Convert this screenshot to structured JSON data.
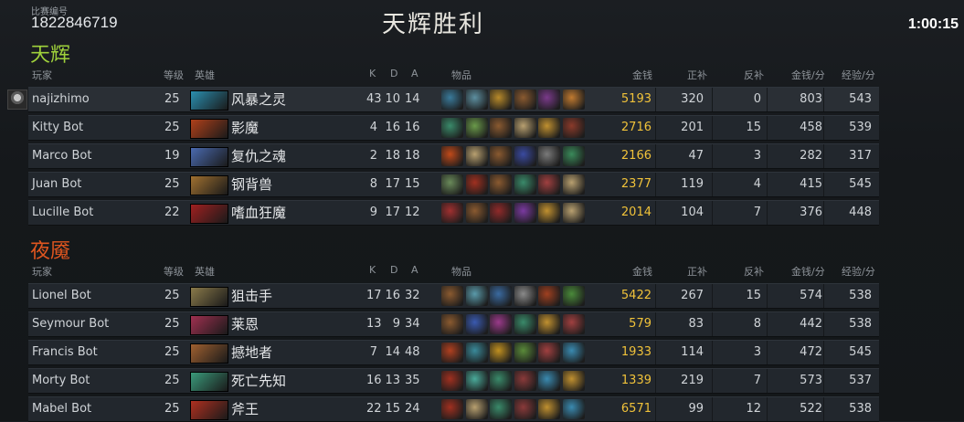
{
  "header": {
    "match_label": "比赛编号",
    "match_id": "1822846719",
    "result": "天辉胜利",
    "time": "1:00:15"
  },
  "columns": {
    "player": "玩家",
    "level": "等级",
    "hero": "英雄",
    "k": "K",
    "d": "D",
    "a": "A",
    "items": "物品",
    "gold": "金钱",
    "last_hits": "正补",
    "denies": "反补",
    "gpm": "金钱/分",
    "xpm": "经验/分"
  },
  "radiant": {
    "name": "天辉",
    "players": [
      {
        "name": "najizhimo",
        "level": "25",
        "hero": "风暴之灵",
        "k": "43",
        "d": "10",
        "a": "14",
        "gold": "5193",
        "lh": "320",
        "dn": "0",
        "gpm": "803",
        "xpm": "543",
        "hero_color": "#2a8fb0",
        "items": [
          "#3a7a9a",
          "#5d8fa0",
          "#b88a2a",
          "#8a5a30",
          "#7a3a8a",
          "#c07a30"
        ]
      },
      {
        "name": "Kitty Bot",
        "level": "25",
        "hero": "影魔",
        "k": "4",
        "d": "16",
        "a": "16",
        "gold": "2716",
        "lh": "201",
        "dn": "15",
        "gpm": "458",
        "xpm": "539",
        "hero_color": "#b0401a",
        "items": [
          "#3a8a6a",
          "#6a9a4a",
          "#8a5a30",
          "#b8a070",
          "#c09030",
          "#8a3a2a"
        ]
      },
      {
        "name": "Marco Bot",
        "level": "19",
        "hero": "复仇之魂",
        "k": "2",
        "d": "18",
        "a": "18",
        "gold": "2166",
        "lh": "47",
        "dn": "3",
        "gpm": "282",
        "xpm": "317",
        "hero_color": "#4a6ab0",
        "items": [
          "#c04a1a",
          "#b8a070",
          "#8a5a30",
          "#3a4aa0",
          "#7a7a7a",
          "#3a8a5a"
        ]
      },
      {
        "name": "Juan Bot",
        "level": "25",
        "hero": "钢背兽",
        "k": "8",
        "d": "17",
        "a": "15",
        "gold": "2377",
        "lh": "119",
        "dn": "4",
        "gpm": "415",
        "xpm": "545",
        "hero_color": "#a07030",
        "items": [
          "#6a8a5a",
          "#a03020",
          "#8a5a30",
          "#3a8a6a",
          "#a04040",
          "#b8a070"
        ]
      },
      {
        "name": "Lucille Bot",
        "level": "22",
        "hero": "嗜血狂魔",
        "k": "9",
        "d": "17",
        "a": "12",
        "gold": "2014",
        "lh": "104",
        "dn": "7",
        "gpm": "376",
        "xpm": "448",
        "hero_color": "#a02020",
        "items": [
          "#a03030",
          "#8a5a30",
          "#902a2a",
          "#7a3aa0",
          "#c09030",
          "#b8a070"
        ]
      }
    ]
  },
  "dire": {
    "name": "夜魇",
    "players": [
      {
        "name": "Lionel Bot",
        "level": "25",
        "hero": "狙击手",
        "k": "17",
        "d": "16",
        "a": "32",
        "gold": "5422",
        "lh": "267",
        "dn": "15",
        "gpm": "574",
        "xpm": "538",
        "hero_color": "#8a7a4a",
        "items": [
          "#8a5a30",
          "#5a9aaa",
          "#3a6aa0",
          "#8a8a8a",
          "#a04020",
          "#4a8a3a"
        ]
      },
      {
        "name": "Seymour Bot",
        "level": "25",
        "hero": "莱恩",
        "k": "13",
        "d": "9",
        "a": "34",
        "gold": "579",
        "lh": "83",
        "dn": "8",
        "gpm": "442",
        "xpm": "538",
        "hero_color": "#a03050",
        "items": [
          "#8a5a30",
          "#3a5ab0",
          "#9a3a8a",
          "#3a8a6a",
          "#c09030",
          "#a04040"
        ]
      },
      {
        "name": "Francis Bot",
        "level": "25",
        "hero": "撼地者",
        "k": "7",
        "d": "14",
        "a": "48",
        "gold": "1933",
        "lh": "114",
        "dn": "3",
        "gpm": "472",
        "xpm": "545",
        "hero_color": "#a06030",
        "items": [
          "#b04020",
          "#3a8a9a",
          "#c09020",
          "#5a8a3a",
          "#a04040",
          "#3a8ab0"
        ]
      },
      {
        "name": "Morty Bot",
        "level": "25",
        "hero": "死亡先知",
        "k": "16",
        "d": "13",
        "a": "35",
        "gold": "1339",
        "lh": "219",
        "dn": "7",
        "gpm": "573",
        "xpm": "537",
        "hero_color": "#3a9a7a",
        "items": [
          "#a03020",
          "#4aaa9a",
          "#3a8a6a",
          "#8a3a3a",
          "#3a8ab0",
          "#c09030"
        ]
      },
      {
        "name": "Mabel Bot",
        "level": "25",
        "hero": "斧王",
        "k": "22",
        "d": "15",
        "a": "24",
        "gold": "6571",
        "lh": "99",
        "dn": "12",
        "gpm": "522",
        "xpm": "538",
        "hero_color": "#b03020",
        "items": [
          "#a03020",
          "#b8a070",
          "#3a8a6a",
          "#8a3a3a",
          "#c09030",
          "#3a8ab0"
        ]
      }
    ]
  }
}
